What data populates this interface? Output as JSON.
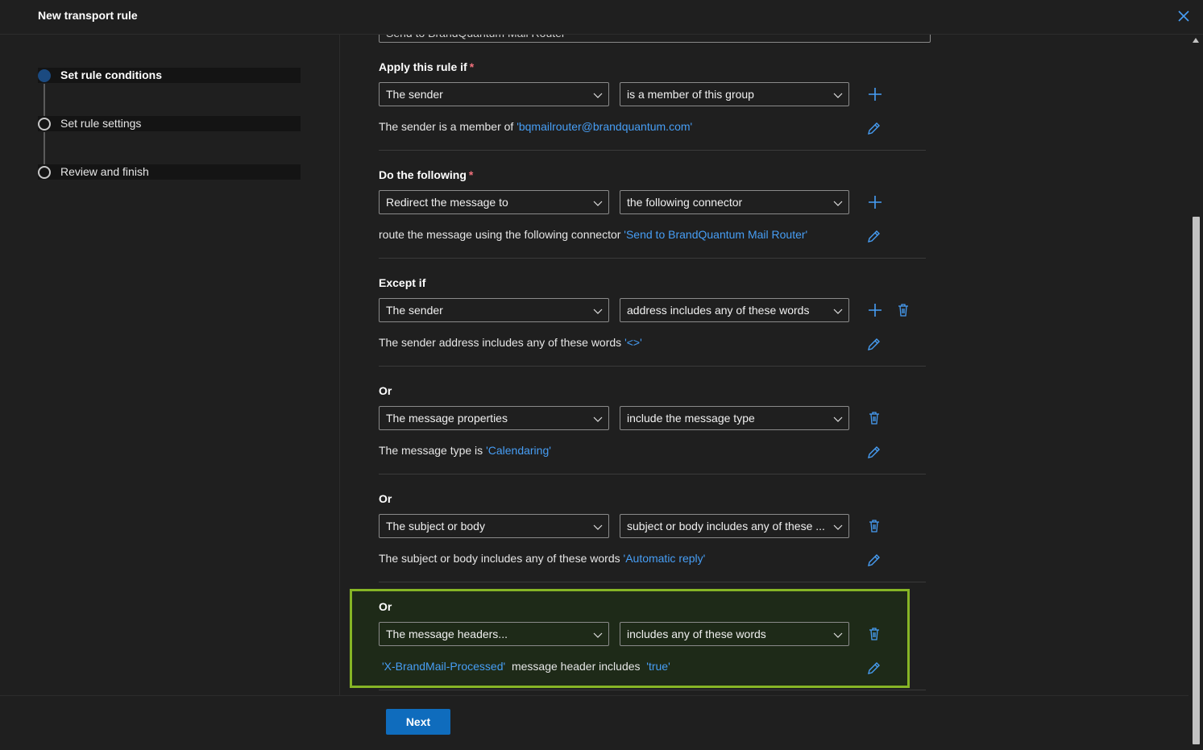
{
  "header": {
    "title": "New transport rule"
  },
  "steps": [
    {
      "label": "Set rule conditions",
      "active": true
    },
    {
      "label": "Set rule settings",
      "active": false
    },
    {
      "label": "Review and finish",
      "active": false
    }
  ],
  "name_field": {
    "value": "Send to BrandQuantum Mail Router"
  },
  "sections": [
    {
      "title": "Apply this rule if",
      "required": "*",
      "dropdown1": "The sender",
      "dropdown2": "is a member of this group",
      "summary_text": "The sender is a member of ",
      "summary_link": "'bqmailrouter@brandquantum.com'"
    },
    {
      "title": "Do the following",
      "required": "*",
      "dropdown1": "Redirect the message to",
      "dropdown2": "the following connector",
      "summary_text": "route the message using the following connector ",
      "summary_link": "'Send to BrandQuantum Mail Router'"
    },
    {
      "title": "Except if",
      "dropdown1": "The sender",
      "dropdown2": "address includes any of these words",
      "summary_text": "The sender address includes any of these words ",
      "summary_link": "'<>'"
    },
    {
      "title": "Or",
      "dropdown1": "The message properties",
      "dropdown2": "include the message type",
      "summary_text": "The message type is ",
      "summary_link": "'Calendaring'"
    },
    {
      "title": "Or",
      "dropdown1": "The subject or body",
      "dropdown2": "subject or body includes any of these ...",
      "summary_text": "The subject or body includes any of these words ",
      "summary_link": "'Automatic reply'"
    },
    {
      "title": "Or",
      "dropdown1": "The message headers...",
      "dropdown2": "includes any of these words",
      "summary_link_a": "'X-BrandMail-Processed'",
      "summary_text": "message header includes",
      "summary_link_b": "'true'"
    }
  ],
  "footer": {
    "next_label": "Next"
  },
  "colors": {
    "accent": "#0f6cbd",
    "link": "#479ef5",
    "highlight_border": "#86b525"
  }
}
